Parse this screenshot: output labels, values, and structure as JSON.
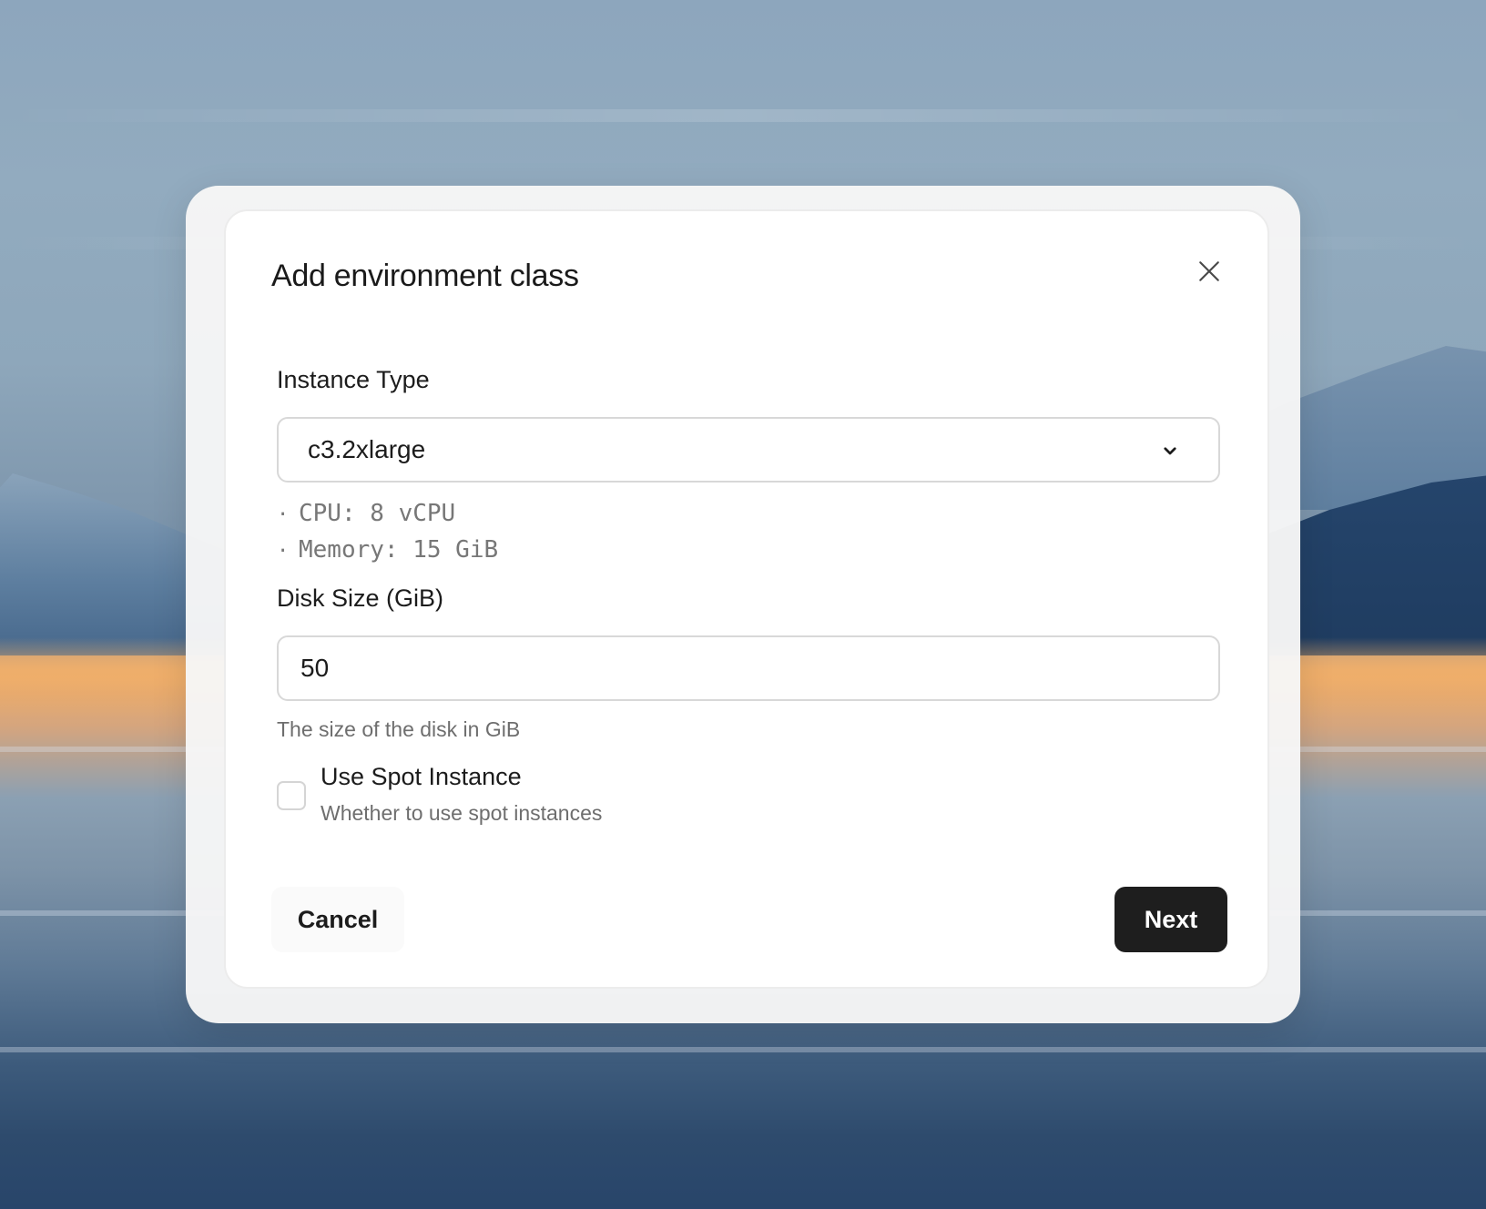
{
  "dialog": {
    "title": "Add environment class",
    "close_icon": "close-icon"
  },
  "instance_type": {
    "label": "Instance Type",
    "selected": "c3.2xlarge",
    "chevron_icon": "chevron-down-icon",
    "specs": [
      {
        "bullet": "·",
        "text": "CPU: 8 vCPU"
      },
      {
        "bullet": "·",
        "text": "Memory: 15 GiB"
      }
    ]
  },
  "disk_size": {
    "label": "Disk Size (GiB)",
    "value": "50",
    "hint": "The size of the disk in GiB"
  },
  "spot_instance": {
    "label": "Use Spot Instance",
    "description": "Whether to use spot instances",
    "checked": false
  },
  "actions": {
    "cancel_label": "Cancel",
    "next_label": "Next"
  },
  "colors": {
    "primary_button": "#1e1e1e",
    "border": "#d8d8d8",
    "muted_text": "#6e6e6e"
  }
}
